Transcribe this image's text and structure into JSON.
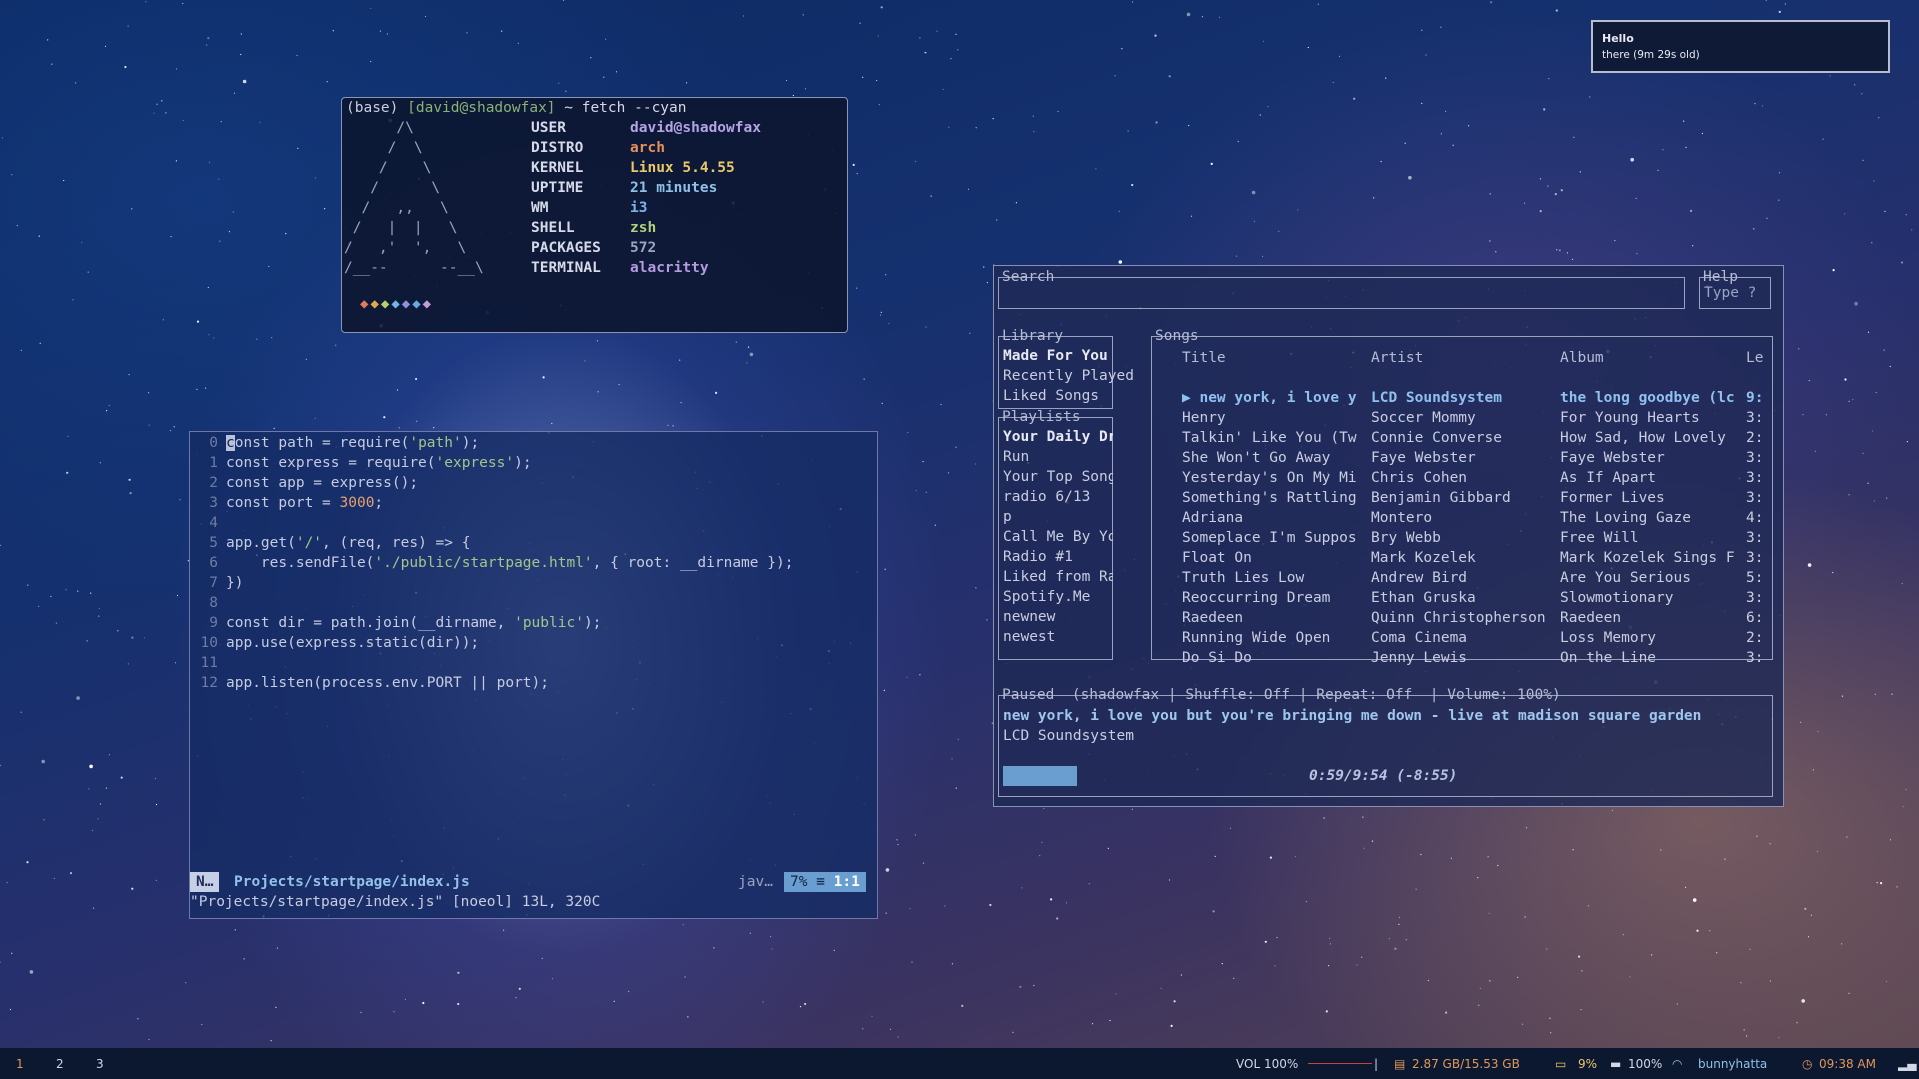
{
  "fetch": {
    "prompt_base": "(base)",
    "prompt_user": "[david@shadowfax]",
    "prompt_cmd": "~ fetch --cyan",
    "art_lines": [
      "      /\\",
      "     /  \\",
      "    /    \\",
      "   /      \\",
      "  /   ,,   \\",
      " /   |  |   \\",
      "/   ,'  ',   \\",
      "/__--      --__\\"
    ],
    "rows": [
      {
        "key": "USER",
        "value": "david@shadowfax",
        "color": "#b3a4e3"
      },
      {
        "key": "DISTRO",
        "value": "arch",
        "color": "#e5915b"
      },
      {
        "key": "KERNEL",
        "value": "Linux 5.4.55",
        "color": "#e9c86c"
      },
      {
        "key": "UPTIME",
        "value": "21 minutes",
        "color": "#8fc1e8"
      },
      {
        "key": "WM",
        "value": "i3",
        "color": "#7fb2e8"
      },
      {
        "key": "SHELL",
        "value": "zsh",
        "color": "#b4cf7a"
      },
      {
        "key": "PACKAGES",
        "value": "572",
        "color": "#9aa3c0"
      },
      {
        "key": "TERMINAL",
        "value": "alacritty",
        "color": "#b49be0"
      }
    ],
    "diamond_colors": [
      "#e07b5c",
      "#e0a84f",
      "#b9cf6d",
      "#6fb7e0",
      "#8f8fe0",
      "#6aa8e0",
      "#c29ad8"
    ]
  },
  "editor": {
    "lines": [
      {
        "n": "0",
        "code": "<span class=\"cursor\">c</span>onst path = require(<span class=\"str\">'path'</span>);"
      },
      {
        "n": "1",
        "code": "const express = require(<span class=\"str\">'express'</span>);"
      },
      {
        "n": "2",
        "code": "const app = express();"
      },
      {
        "n": "3",
        "code": "const port = <span class=\"num\">3000</span>;"
      },
      {
        "n": "4",
        "code": ""
      },
      {
        "n": "5",
        "code": "app.get(<span class=\"str\">'/'</span>, (req, res) => {"
      },
      {
        "n": "6",
        "code": "    res.sendFile(<span class=\"str\">'./public/startpage.html'</span>, { root: __dirname });"
      },
      {
        "n": "7",
        "code": "})"
      },
      {
        "n": "8",
        "code": ""
      },
      {
        "n": "9",
        "code": "const dir = path.join(__dirname, <span class=\"str\">'public'</span>);"
      },
      {
        "n": "10",
        "code": "app.use(express.static(dir));"
      },
      {
        "n": "11",
        "code": ""
      },
      {
        "n": "12",
        "code": "app.listen(process.env.PORT || port);"
      }
    ],
    "mode": "N…",
    "filename": "Projects/startpage/index.js",
    "filetype": "jav…",
    "position_pct": "7%",
    "position_icon": "≡",
    "position": "1:1",
    "message": "\"Projects/startpage/index.js\" [noeol] 13L, 320C"
  },
  "spotify": {
    "search_title": "Search",
    "help_title": "Help",
    "help_text": "Type ?",
    "library_title": "Library",
    "library_items": [
      "Made For You",
      "Recently Played",
      "Liked Songs"
    ],
    "playlists_title": "Playlists",
    "playlists": [
      "Your Daily Driv",
      "Run",
      "Your Top Songs",
      "radio 6/13",
      "p",
      "Call Me By Your",
      "Radio #1",
      "Liked from Radi",
      "Spotify.Me",
      "newnew",
      "newest"
    ],
    "songs_title": "Songs",
    "columns": {
      "title": "Title",
      "artist": "Artist",
      "album": "Album",
      "length": "Le"
    },
    "songs": [
      {
        "title": "▶ new york, i love y",
        "artist": "LCD Soundsystem",
        "album": "the long goodbye (lc",
        "length": "9:"
      },
      {
        "title": "Henry",
        "artist": "Soccer Mommy",
        "album": "For Young Hearts",
        "length": "3:"
      },
      {
        "title": "Talkin' Like You (Tw",
        "artist": "Connie Converse",
        "album": "How Sad, How Lovely",
        "length": "2:"
      },
      {
        "title": "She Won't Go Away",
        "artist": "Faye Webster",
        "album": "Faye Webster",
        "length": "3:"
      },
      {
        "title": "Yesterday's On My Mi",
        "artist": "Chris Cohen",
        "album": "As If Apart",
        "length": "3:"
      },
      {
        "title": "Something's Rattling",
        "artist": "Benjamin Gibbard",
        "album": "Former Lives",
        "length": "3:"
      },
      {
        "title": "Adriana",
        "artist": "Montero",
        "album": "The Loving Gaze",
        "length": "4:"
      },
      {
        "title": "Someplace I'm Suppos",
        "artist": "Bry Webb",
        "album": "Free Will",
        "length": "3:"
      },
      {
        "title": "Float On",
        "artist": "Mark Kozelek",
        "album": "Mark Kozelek Sings F",
        "length": "3:"
      },
      {
        "title": "Truth Lies Low",
        "artist": "Andrew Bird",
        "album": "Are You Serious",
        "length": "5:"
      },
      {
        "title": "Reoccurring Dream",
        "artist": "Ethan Gruska",
        "album": "Slowmotionary",
        "length": "3:"
      },
      {
        "title": "Raedeen",
        "artist": "Quinn Christopherson",
        "album": "Raedeen",
        "length": "6:"
      },
      {
        "title": "Running Wide Open",
        "artist": "Coma Cinema",
        "album": "Loss Memory",
        "length": "2:"
      },
      {
        "title": "Do Si Do",
        "artist": "Jenny Lewis",
        "album": "On the Line",
        "length": "3:"
      }
    ],
    "playback_title": "Paused  (shadowfax | Shuffle: Off | Repeat: Off  | Volume: 100%)",
    "now_playing_title": "new york, i love you but you're bringing me down - live at madison square garden",
    "now_playing_artist": "LCD Soundsystem",
    "progress_text": "0:59/9:54 (-8:55)",
    "progress_fraction": 0.1
  },
  "notification": {
    "title": "Hello",
    "body": "there (9m 29s old)"
  },
  "bar": {
    "workspaces": [
      "1",
      "2",
      "3"
    ],
    "volume": "VOL 100%",
    "disk": "2.87 GB/15.53 GB",
    "cpu": "9%",
    "battery": "100%",
    "wifi": "bunnyhatta",
    "time": "09:38 AM"
  }
}
